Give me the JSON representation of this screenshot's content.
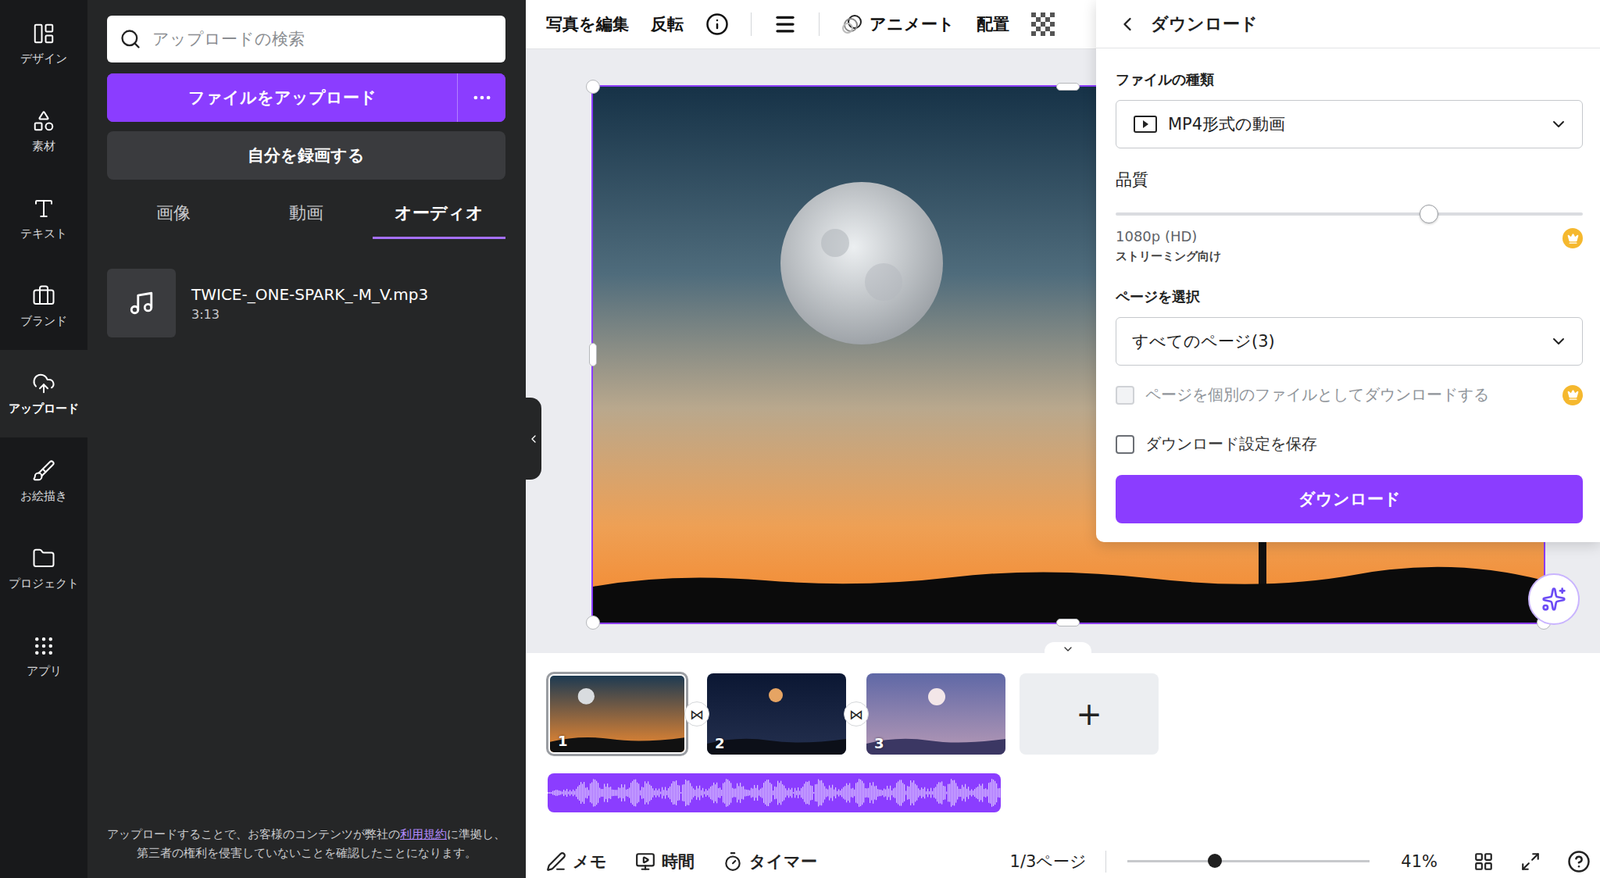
{
  "rail": [
    {
      "label": "デザイン",
      "selected": false
    },
    {
      "label": "素材",
      "selected": false
    },
    {
      "label": "テキスト",
      "selected": false
    },
    {
      "label": "ブランド",
      "selected": false
    },
    {
      "label": "アップロード",
      "selected": true
    },
    {
      "label": "お絵描き",
      "selected": false
    },
    {
      "label": "プロジェクト",
      "selected": false
    },
    {
      "label": "アプリ",
      "selected": false
    }
  ],
  "search": {
    "placeholder": "アップロードの検索"
  },
  "upload_button": "ファイルをアップロード",
  "record_button": "自分を録画する",
  "media_tabs": [
    {
      "label": "画像",
      "selected": false
    },
    {
      "label": "動画",
      "selected": false
    },
    {
      "label": "オーディオ",
      "selected": true
    }
  ],
  "audio_files": [
    {
      "name": "TWICE-_ONE-SPARK_-M_V.mp3",
      "duration": "3:13"
    }
  ],
  "terms": {
    "before": "アップロードすることで、お客様のコンテンツが弊社の",
    "link": "利用規約",
    "after": "に準拠し、第三者の権利を侵害していないことを確認したことになります。"
  },
  "toolbar": [
    {
      "kind": "text",
      "label": "写真を編集"
    },
    {
      "kind": "text",
      "label": "反転"
    },
    {
      "kind": "info"
    },
    {
      "kind": "separator"
    },
    {
      "kind": "lines"
    },
    {
      "kind": "separator"
    },
    {
      "kind": "animate",
      "label": "アニメート"
    },
    {
      "kind": "text",
      "label": "配置"
    },
    {
      "kind": "transparency"
    }
  ],
  "download_panel": {
    "title": "ダウンロード",
    "file_type_label": "ファイルの種類",
    "file_type": "MP4形式の動画",
    "quality_label": "品質",
    "quality_level": 0.67,
    "quality_value": "1080p (HD)",
    "quality_hint": "ストリーミング向け",
    "quality_premium": true,
    "pages_label": "ページを選択",
    "pages": "すべてのページ(3)",
    "options": [
      {
        "label": "ページを個別のファイルとしてダウンロードする",
        "checked": false,
        "disabled": true,
        "premium": true
      },
      {
        "label": "ダウンロード設定を保存",
        "checked": false,
        "disabled": false,
        "premium": false
      }
    ],
    "button": "ダウンロード"
  },
  "pages": [
    {
      "number": "1",
      "selected": true
    },
    {
      "number": "2",
      "selected": false
    },
    {
      "number": "3",
      "selected": false
    }
  ],
  "transition": "⋈",
  "add_page": "+",
  "bottom_bar": {
    "notes": "メモ",
    "time": "時間",
    "timer": "タイマー",
    "page_indicator": "1/3ページ",
    "zoom_level": 0.36,
    "zoom": "41%"
  }
}
